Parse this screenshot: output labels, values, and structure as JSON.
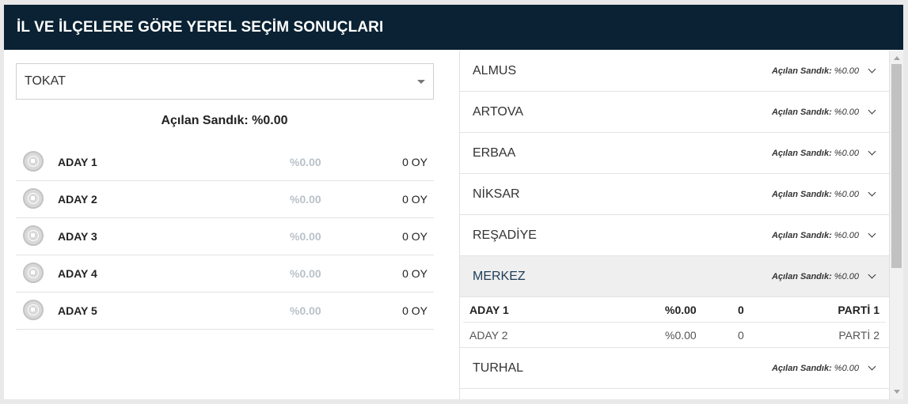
{
  "header": {
    "title": "İL VE İLÇELERE GÖRE YEREL SEÇİM SONUÇLARI"
  },
  "province_select": {
    "value": "TOKAT",
    "icon": "caret-down-icon"
  },
  "summary": {
    "opened_ballot": "Açılan Sandık: %0.00"
  },
  "candidates": [
    {
      "name": "ADAY 1",
      "pct": "%0.00",
      "votes": "0 OY"
    },
    {
      "name": "ADAY 2",
      "pct": "%0.00",
      "votes": "0 OY"
    },
    {
      "name": "ADAY 3",
      "pct": "%0.00",
      "votes": "0 OY"
    },
    {
      "name": "ADAY 4",
      "pct": "%0.00",
      "votes": "0 OY"
    },
    {
      "name": "ADAY 5",
      "pct": "%0.00",
      "votes": "0 OY"
    }
  ],
  "districts": [
    {
      "name": "ALMUS",
      "stat_label": "Açılan Sandık:",
      "stat_value": "%0.00"
    },
    {
      "name": "ARTOVA",
      "stat_label": "Açılan Sandık:",
      "stat_value": "%0.00"
    },
    {
      "name": "ERBAA",
      "stat_label": "Açılan Sandık:",
      "stat_value": "%0.00"
    },
    {
      "name": "NİKSAR",
      "stat_label": "Açılan Sandık:",
      "stat_value": "%0.00"
    },
    {
      "name": "REŞADİYE",
      "stat_label": "Açılan Sandık:",
      "stat_value": "%0.00"
    },
    {
      "name": "MERKEZ",
      "stat_label": "Açılan Sandık:",
      "stat_value": "%0.00"
    },
    {
      "name": "TURHAL",
      "stat_label": "Açılan Sandık:",
      "stat_value": "%0.00"
    }
  ],
  "expanded_detail": [
    {
      "candidate": "ADAY 1",
      "pct": "%0.00",
      "votes": "0",
      "party": "PARTİ 1"
    },
    {
      "candidate": "ADAY 2",
      "pct": "%0.00",
      "votes": "0",
      "party": "PARTİ 2"
    }
  ],
  "colors": {
    "header_bg": "#0a2233",
    "active_row_bg": "#efefef",
    "muted_pct": "#b9c2c9"
  }
}
